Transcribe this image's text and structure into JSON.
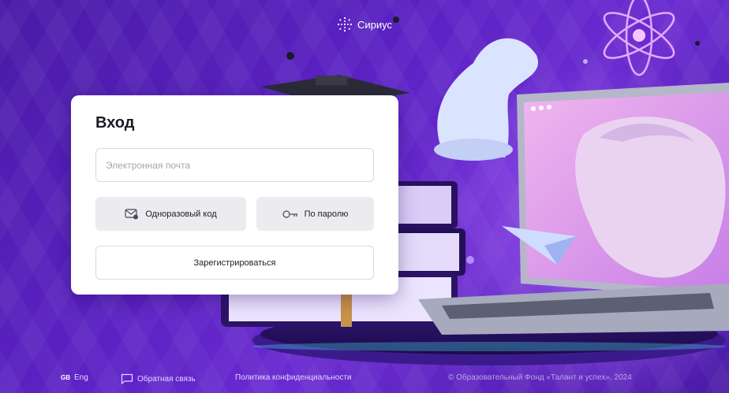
{
  "logo": {
    "text": "Сириус",
    "icon": "sirius-logo-icon"
  },
  "login": {
    "title": "Вход",
    "email_placeholder": "Электронная почта",
    "email_value": "",
    "otp_button": "Одноразовый код",
    "password_button": "По паролю",
    "register_button": "Зарегистрироваться"
  },
  "footer": {
    "lang_code": "GB",
    "lang_label": "Eng",
    "feedback": "Обратная связь",
    "privacy": "Политика конфиденциальности",
    "copyright": "© Образовательный Фонд «Талант и успех», 2024"
  },
  "colors": {
    "background": "#5c22c4",
    "card": "#ffffff",
    "button_gray": "#ececf0",
    "text_dark": "#1c1c28"
  }
}
